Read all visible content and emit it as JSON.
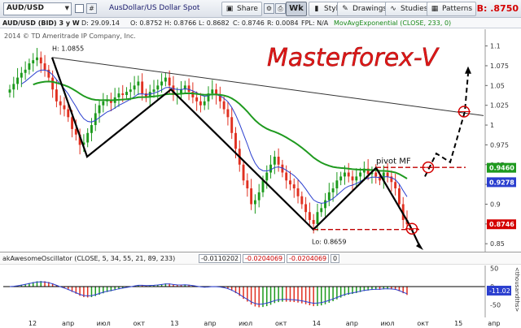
{
  "toolbar": {
    "symbol": "AUD/USD",
    "description": "AusDollar/US Dollar Spot",
    "share": "Share",
    "period": "Wk",
    "style": "Style",
    "drawings": "Drawings",
    "studies": "Studies",
    "patterns": "Patterns",
    "bid_prefix": "B:",
    "bid_price": ".8750"
  },
  "info": {
    "instrument": "AUD/USD (BID) 3 y W",
    "date": "D: 29.09.14",
    "open": "O: 0.8752",
    "high": "H: 0.8766",
    "low": "L: 0.8682",
    "close": "C: 0.8746",
    "range": "R: 0.0084",
    "fpl": "FPL: N/A",
    "ma_study": "MovAvgExponential (CLOSE, 233, 0)",
    "copyright": "2014 © TD Ameritrade IP Company, Inc."
  },
  "annotations": {
    "watermark": "Masterforex-V",
    "pivot": "pivot MF",
    "high_label": "H: 1.0855",
    "low_label": "Lo: 0.8659"
  },
  "colors": {
    "accent_red": "#d40000",
    "ema_green": "#1f9a1f",
    "ma_blue": "#2b3fcf",
    "price_red": "#e03020",
    "price_green": "#1c9a1c"
  },
  "chart_data": {
    "type": "candlestick",
    "series_note": "AUD/USD weekly close (approx)",
    "price_axis": {
      "ticks": [
        "1.1",
        "1.075",
        "1.05",
        "1.025",
        "1",
        "0.975",
        "0.95",
        "0.925",
        "0.9",
        "0.875",
        "0.85"
      ],
      "ylim": [
        0.842,
        1.115
      ]
    },
    "price_tags": [
      {
        "label": "0.9460",
        "value": 0.946,
        "color": "#1f9a1f"
      },
      {
        "label": "0.9278",
        "value": 0.9278,
        "color": "#2b3fcf"
      },
      {
        "label": "0.8746",
        "value": 0.8746,
        "color": "#d40000"
      }
    ],
    "x_labels": [
      "12",
      "апр",
      "июл",
      "окт",
      "13",
      "апр",
      "июл",
      "окт",
      "14",
      "апр",
      "июл",
      "окт",
      "15",
      "апр"
    ],
    "closes": [
      1.045,
      1.052,
      1.06,
      1.066,
      1.07,
      1.078,
      1.082,
      1.0855,
      1.078,
      1.07,
      1.06,
      1.045,
      1.03,
      1.025,
      1.02,
      1.01,
      0.995,
      0.988,
      0.975,
      0.978,
      0.99,
      1.0,
      1.015,
      1.025,
      1.03,
      1.032,
      1.028,
      1.035,
      1.04,
      1.038,
      1.042,
      1.045,
      1.05,
      1.055,
      1.04,
      1.035,
      1.042,
      1.045,
      1.05,
      1.055,
      1.06,
      1.05,
      1.038,
      1.04,
      1.045,
      1.05,
      1.042,
      1.035,
      1.03,
      1.025,
      1.03,
      1.04,
      1.045,
      1.038,
      1.03,
      1.02,
      1.01,
      0.99,
      0.97,
      0.95,
      0.93,
      0.92,
      0.9,
      0.905,
      0.915,
      0.93,
      0.94,
      0.95,
      0.96,
      0.95,
      0.94,
      0.93,
      0.925,
      0.92,
      0.91,
      0.9,
      0.89,
      0.88,
      0.875,
      0.89,
      0.895,
      0.905,
      0.915,
      0.92,
      0.93,
      0.935,
      0.94,
      0.935,
      0.93,
      0.935,
      0.94,
      0.945,
      0.938,
      0.94,
      0.935,
      0.93,
      0.94,
      0.935,
      0.928,
      0.92,
      0.9,
      0.88,
      0.8746
    ],
    "ema233_note": "green long-term EMA",
    "oscillator": {
      "name": "akAwesomeOscillator (CLOSE, 5, 34, 55, 21, 89, 233)",
      "values": [
        "-0.0110202",
        "-0.0204069",
        "-0.0204069",
        "0"
      ],
      "ticks": [
        "50",
        "0",
        "-50"
      ],
      "readout": "-11.02",
      "axis_unit": "<thousandths>"
    }
  }
}
